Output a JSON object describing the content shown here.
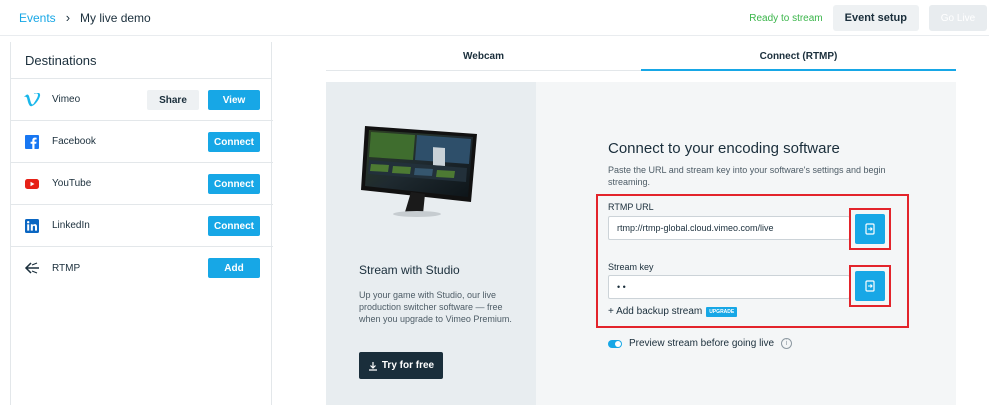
{
  "breadcrumb": {
    "parent": "Events",
    "separator": "›",
    "current": "My live demo"
  },
  "header": {
    "status": "Ready to stream",
    "event_setup": "Event setup",
    "go_live": "Go Live"
  },
  "sidebar": {
    "title": "Destinations",
    "items": [
      {
        "label": "Vimeo",
        "secondary_action": "Share",
        "action": "View",
        "icon": "vimeo-icon"
      },
      {
        "label": "Facebook",
        "action": "Connect",
        "icon": "facebook-icon"
      },
      {
        "label": "YouTube",
        "action": "Connect",
        "icon": "youtube-icon"
      },
      {
        "label": "LinkedIn",
        "action": "Connect",
        "icon": "linkedin-icon"
      },
      {
        "label": "RTMP",
        "action": "Add",
        "icon": "rtmp-icon"
      }
    ]
  },
  "tabs": [
    {
      "label": "Webcam",
      "active": false
    },
    {
      "label": "Connect (RTMP)",
      "active": true
    }
  ],
  "studio": {
    "title": "Stream with Studio",
    "description": "Up your game with Studio, our live production switcher software — free when you upgrade to Vimeo Premium.",
    "button": "Try for free"
  },
  "encoder": {
    "title": "Connect to your encoding software",
    "description": "Paste the URL and stream key into your software's settings and begin streaming.",
    "rtmp_label": "RTMP URL",
    "rtmp_value": "rtmp://rtmp-global.cloud.vimeo.com/live",
    "key_label": "Stream key",
    "key_value": "• •",
    "backup": "+ Add backup stream",
    "upgrade": "UPGRADE",
    "preview": "Preview stream before going live",
    "info": "i"
  },
  "colors": {
    "accent": "#17a7e6",
    "highlight": "#e3242b",
    "ready": "#3ab54a",
    "dark": "#1a2e3b"
  }
}
